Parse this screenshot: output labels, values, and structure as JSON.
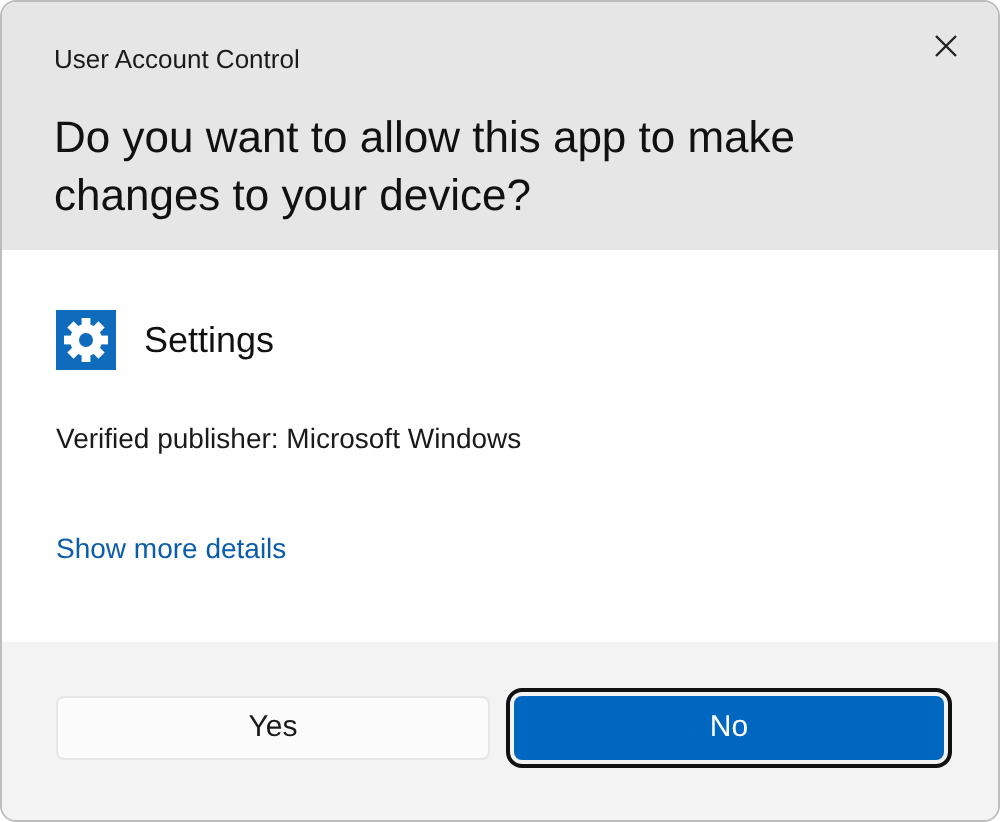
{
  "window": {
    "title": "User Account Control"
  },
  "question": "Do you want to allow this app to make changes to your device?",
  "app": {
    "name": "Settings"
  },
  "publisher": "Verified publisher: Microsoft Windows",
  "details_link": "Show more details",
  "buttons": [
    {
      "label": "Yes",
      "default": false
    },
    {
      "label": "No",
      "default": true
    }
  ]
}
